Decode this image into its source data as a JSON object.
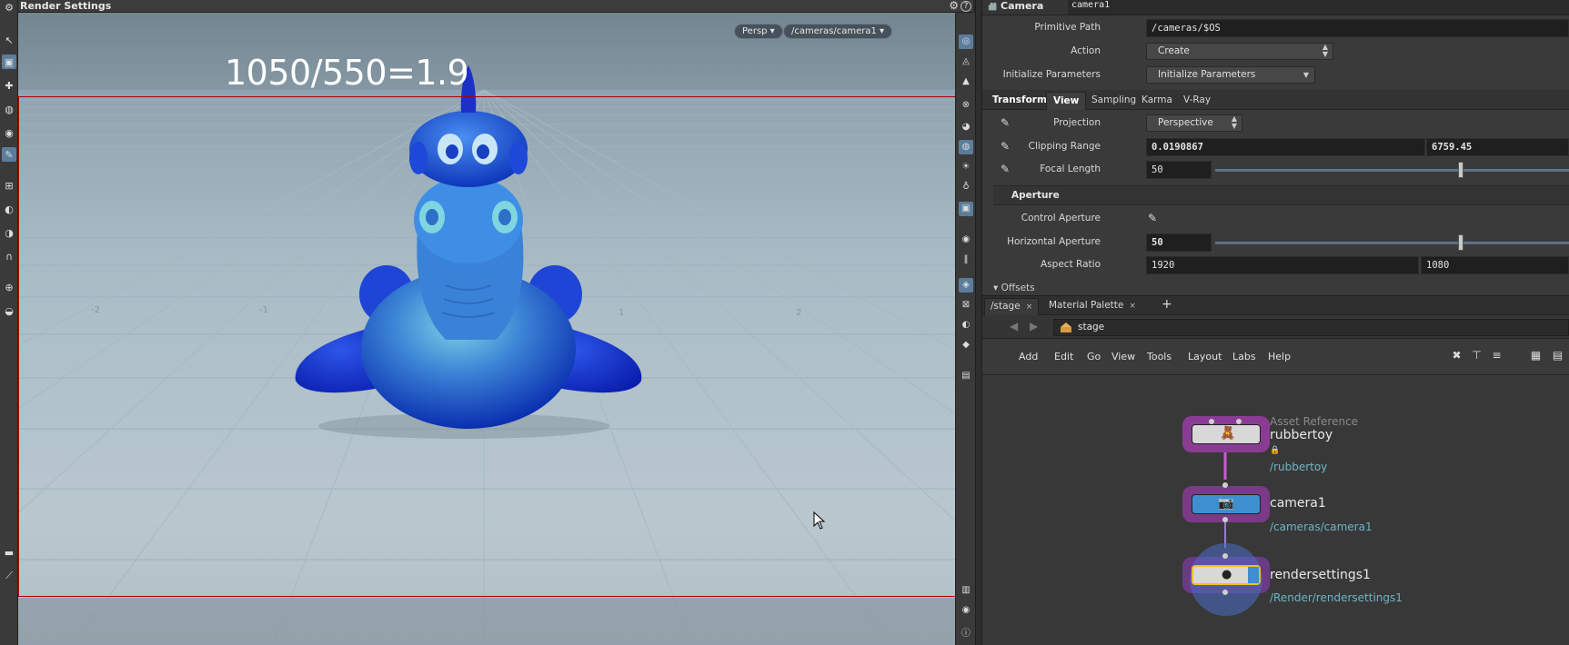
{
  "viewport": {
    "title": "Render Settings",
    "overlay_text": "1050/550=1.9",
    "persp_label": "Persp ▾",
    "camera_label": "/cameras/camera1 ▾",
    "lock_glyph": "🔒",
    "gear_glyph": "⚙",
    "help_glyph": "?"
  },
  "params": {
    "node_type": "Camera",
    "node_name": "camera1",
    "primitive_path_label": "Primitive Path",
    "primitive_path_value": "/cameras/$OS",
    "action_label": "Action",
    "action_value": "Create",
    "init_params_label": "Initialize Parameters",
    "init_params_value": "Initialize Parameters",
    "tabs": [
      "Transform",
      "View",
      "Sampling",
      "Karma",
      "V-Ray"
    ],
    "projection_label": "Projection",
    "projection_value": "Perspective",
    "clipping_label": "Clipping Range",
    "clipping_near": "0.0190867",
    "clipping_far": "6759.45",
    "focal_label": "Focal Length",
    "focal_value": "50",
    "aperture_section": "Aperture",
    "control_aperture_label": "Control Aperture",
    "h_aperture_label": "Horizontal Aperture",
    "h_aperture_value": "50",
    "aspect_label": "Aspect Ratio",
    "aspect_w": "1920",
    "aspect_h": "1080",
    "offsets_label": "▾ Offsets"
  },
  "network": {
    "tabs": [
      {
        "label": "/stage",
        "close": "×"
      },
      {
        "label": "Material Palette",
        "close": "×"
      }
    ],
    "plus": "+",
    "path": "stage",
    "menu": [
      "Add",
      "Edit",
      "Go",
      "View",
      "Tools",
      "Layout",
      "Labs",
      "Help"
    ],
    "nodes": [
      {
        "type": "Asset Reference",
        "name": "rubbertoy",
        "path": "/rubbertoy",
        "glyph": "🧸"
      },
      {
        "name": "camera1",
        "path": "/cameras/camera1",
        "glyph": "📷"
      },
      {
        "name": "rendersettings1",
        "path": "/Render/rendersettings1",
        "glyph": "●"
      }
    ]
  },
  "colors": {
    "safe_frame": "#b00000",
    "node_purple": "#7a3a86",
    "camera_blue": "#3d8fd0",
    "link_color": "#6fb4c6"
  }
}
